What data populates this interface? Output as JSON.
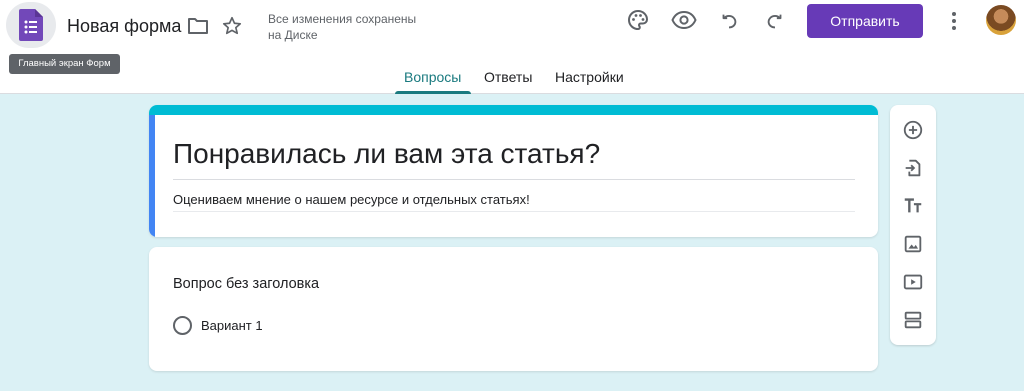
{
  "header": {
    "logo_tooltip": "Главный экран Форм",
    "title": "Новая форма",
    "save_status_line1": "Все изменения сохранены",
    "save_status_line2": "на Диске",
    "send_label": "Отправить",
    "icons": [
      "forms-logo-icon",
      "folder-icon",
      "star-icon",
      "palette-icon",
      "preview-eye-icon",
      "undo-icon",
      "redo-icon",
      "more-vert-icon",
      "avatar"
    ]
  },
  "tabs": [
    {
      "label": "Вопросы",
      "active": true
    },
    {
      "label": "Ответы",
      "active": false
    },
    {
      "label": "Настройки",
      "active": false
    }
  ],
  "form": {
    "title": "Понравилась ли вам эта статья?",
    "description": "Оцениваем мнение о нашем ресурсе и отдельных статьях!"
  },
  "question": {
    "title": "Вопрос без заголовка",
    "options": [
      "Вариант 1"
    ]
  },
  "toolbar": {
    "tools": [
      "add-question-icon",
      "import-questions-icon",
      "add-title-icon",
      "add-image-icon",
      "add-video-icon",
      "add-section-icon"
    ]
  },
  "colors": {
    "accent": "#673ab7",
    "tab_active": "#1a7a7f",
    "page_bg": "#dbf1f5",
    "card_top": "#00bcd4",
    "card_left": "#4285f4"
  }
}
